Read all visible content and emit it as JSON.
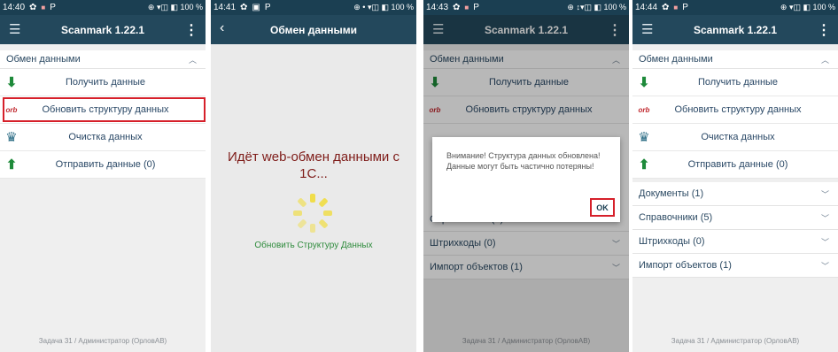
{
  "screens": [
    {
      "status_time": "14:40",
      "status_right": "⊕ ▾◫ ◧ 100 %",
      "title": "Scanmark 1.22.1",
      "section": "Обмен данными",
      "actions": [
        {
          "icon": "download-icon",
          "glyph": "⬇",
          "label": "Получить данные"
        },
        {
          "icon": "sync-icon",
          "glyph": "⇄",
          "label": "Обновить структуру данных"
        },
        {
          "icon": "trash-icon",
          "glyph": "⌂",
          "label": "Очистка данных"
        },
        {
          "icon": "upload-icon",
          "glyph": "⬆",
          "label": "Отправить данные (0)"
        }
      ],
      "footer": "Задача 31 / Администратор (ОрловАВ)"
    },
    {
      "status_time": "14:41",
      "status_right": "⊕ • ▾◫ ◧ 100 %",
      "title": "Обмен данными",
      "message": "Идёт web-обмен данными с 1С...",
      "sub": "Обновить  Структуру Данных"
    },
    {
      "status_time": "14:43",
      "status_right": "⊕ ↕▾◫ ◧ 100 %",
      "title": "Scanmark 1.22.1",
      "section": "Обмен данными",
      "actions": [
        {
          "label": "Получить данные"
        },
        {
          "label": "Обновить структуру данных"
        }
      ],
      "groups": [
        "Справочники (5)",
        "Штрихкоды (0)",
        "Импорт объектов (1)"
      ],
      "dialog_message": "Внимание! Структура данных обновлена! Данные могут быть частично потеряны!",
      "dialog_ok": "OK",
      "footer": "Задача 31 / Администратор (ОрловАВ)"
    },
    {
      "status_time": "14:44",
      "status_right": "⊕ ▾◫ ◧ 100 %",
      "title": "Scanmark 1.22.1",
      "section": "Обмен данными",
      "actions": [
        {
          "label": "Получить данные"
        },
        {
          "label": "Обновить структуру данных"
        },
        {
          "label": "Очистка данных"
        },
        {
          "label": "Отправить данные (0)"
        }
      ],
      "groups": [
        "Документы (1)",
        "Справочники (5)",
        "Штрихкоды (0)",
        "Импорт объектов (1)"
      ],
      "footer": "Задача 31 / Администратор (ОрловАВ)"
    }
  ],
  "colors": {
    "appbar": "#23485c",
    "statusbar": "#1b3f52",
    "highlight": "#d6202a",
    "accent_green": "#1e8a3a"
  }
}
